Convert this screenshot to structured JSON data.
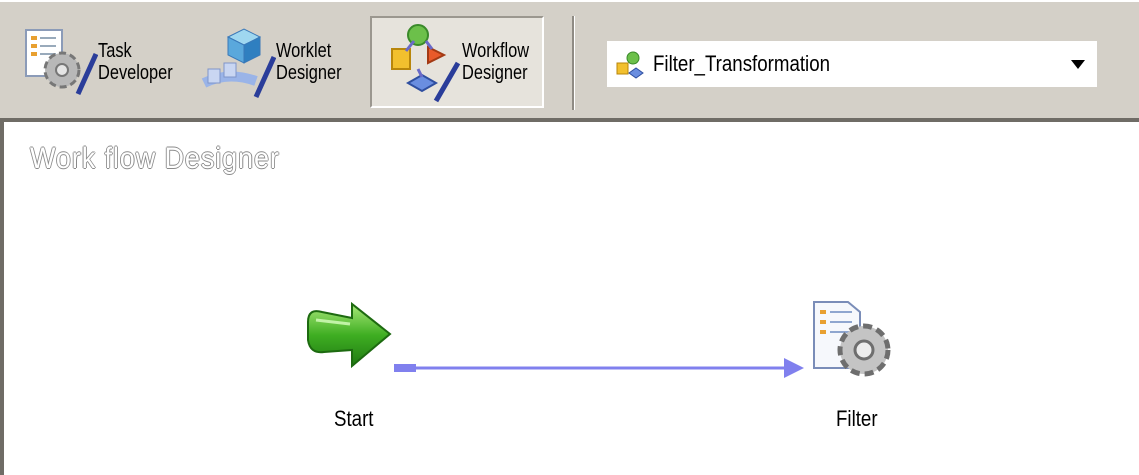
{
  "toolbar": {
    "task_developer_label": "Task\nDeveloper",
    "worklet_designer_label": "Worklet\nDesigner",
    "workflow_designer_label": "Workflow\nDesigner",
    "selected_tool": "Workflow Designer",
    "workflow_selector": {
      "selected_value": "Filter_Transformation"
    }
  },
  "canvas": {
    "title": "Work flow Designer",
    "nodes": [
      {
        "label": "Start",
        "icon": "start-arrow-icon"
      },
      {
        "label": "Filter",
        "icon": "session-task-icon"
      }
    ],
    "link_color": "#8080ee"
  }
}
